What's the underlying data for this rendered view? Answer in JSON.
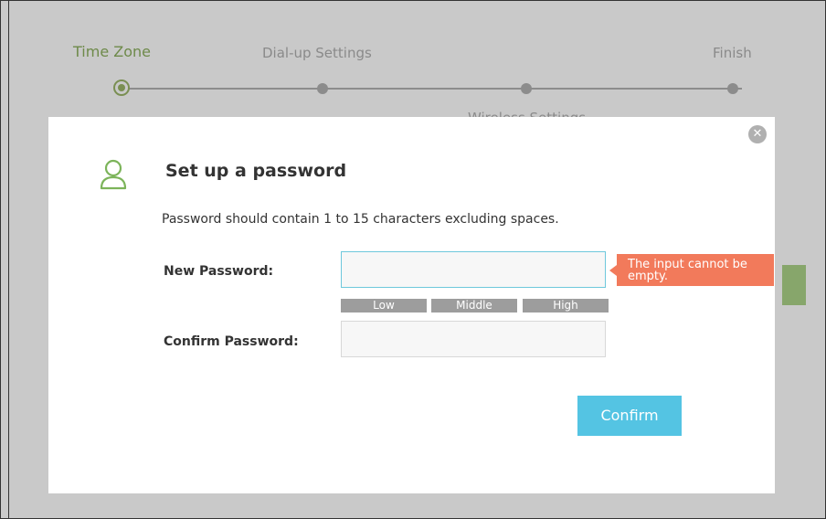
{
  "wizard": {
    "steps": [
      "Time Zone",
      "Dial-up Settings",
      "Wireless Settings",
      "Finish"
    ],
    "active_step": 0
  },
  "modal": {
    "title": "Set up a password",
    "description": "Password should contain 1 to 15 characters excluding spaces.",
    "new_password_label": "New Password:",
    "new_password_value": "",
    "confirm_password_label": "Confirm Password:",
    "confirm_password_value": "",
    "strength": [
      "Low",
      "Middle",
      "High"
    ],
    "error": "The input cannot be empty.",
    "confirm_label": "Confirm",
    "icons": {
      "close": "close-icon",
      "user": "user-icon"
    }
  },
  "colors": {
    "accent_green": "#7a8f52",
    "error": "#f27a5b",
    "button": "#54c4e3",
    "input_focus_border": "#6ec8dc"
  }
}
